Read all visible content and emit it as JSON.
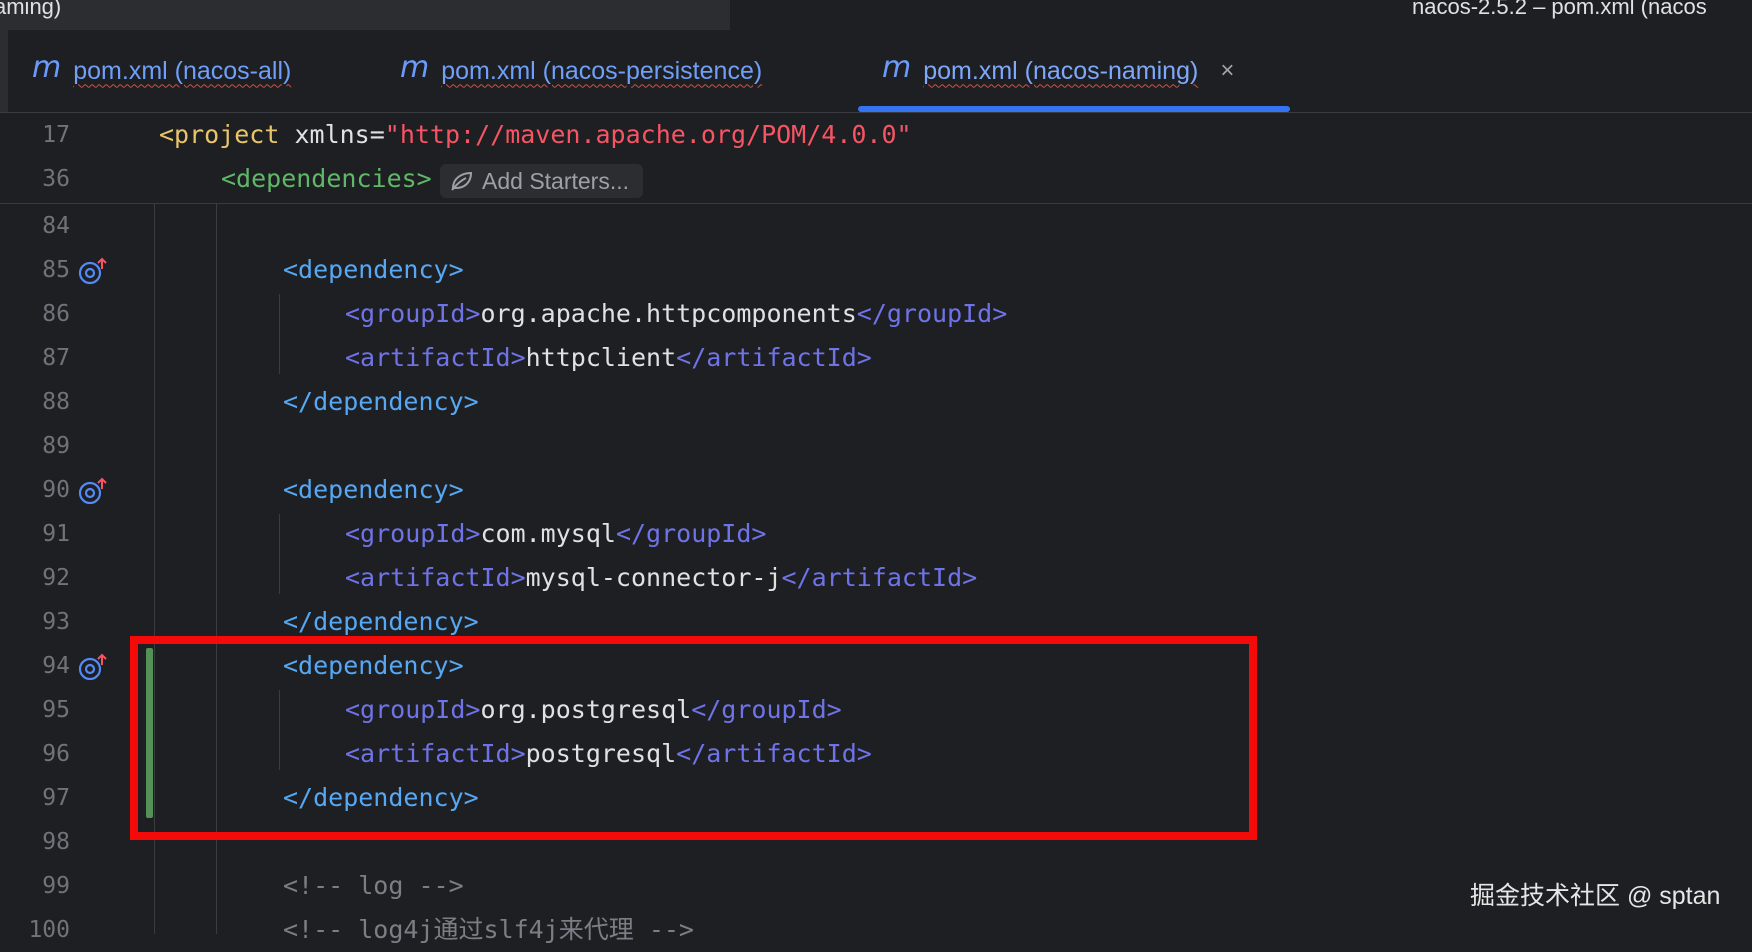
{
  "titlebar": {
    "left_text": "aming)",
    "right_text": "nacos-2.5.2 – pom.xml (nacos"
  },
  "tabs": [
    {
      "icon": "m",
      "label": "pom.xml (nacos-all)",
      "active": false
    },
    {
      "icon": "m",
      "label": "pom.xml (nacos-persistence)",
      "active": false
    },
    {
      "icon": "m",
      "label": "pom.xml (nacos-naming)",
      "active": true,
      "close": "×"
    }
  ],
  "sticky": {
    "line17": {
      "num": "17",
      "tag_open": "<project",
      "attr": " xmlns=",
      "value": "\"http://maven.apache.org/POM/4.0.0\""
    },
    "line36": {
      "num": "36",
      "tag": "<dependencies>",
      "starters_label": "Add Starters..."
    }
  },
  "code_lines": [
    {
      "num": "84"
    },
    {
      "num": "85",
      "open": "<dependency>"
    },
    {
      "num": "86",
      "open": "<groupId>",
      "value": "org.apache.httpcomponents",
      "close": "</groupId>"
    },
    {
      "num": "87",
      "open": "<artifactId>",
      "value": "httpclient",
      "close": "</artifactId>"
    },
    {
      "num": "88",
      "close": "</dependency>"
    },
    {
      "num": "89"
    },
    {
      "num": "90",
      "open": "<dependency>"
    },
    {
      "num": "91",
      "open": "<groupId>",
      "value": "com.mysql",
      "close": "</groupId>"
    },
    {
      "num": "92",
      "open": "<artifactId>",
      "value": "mysql-connector-j",
      "close": "</artifactId>"
    },
    {
      "num": "93",
      "close": "</dependency>"
    },
    {
      "num": "94",
      "open": "<dependency>"
    },
    {
      "num": "95",
      "open": "<groupId>",
      "value": "org.postgresql",
      "close": "</groupId>"
    },
    {
      "num": "96",
      "open": "<artifactId>",
      "value": "postgresql",
      "close": "</artifactId>"
    },
    {
      "num": "97",
      "close": "</dependency>"
    },
    {
      "num": "98"
    },
    {
      "num": "99",
      "comment": "<!-- log -->"
    },
    {
      "num": "100",
      "comment": "<!-- log4j通过slf4j来代理 -->"
    }
  ],
  "watermark": "掘金技术社区 @ sptan",
  "colors": {
    "background": "#1e1f22",
    "tag_blue": "#56a8f5",
    "tag_purple": "#6f73e8",
    "string_red": "#f75464",
    "highlight_box": "#f50a0a",
    "change_bar": "#549159",
    "active_tab_underline": "#3574f0"
  }
}
